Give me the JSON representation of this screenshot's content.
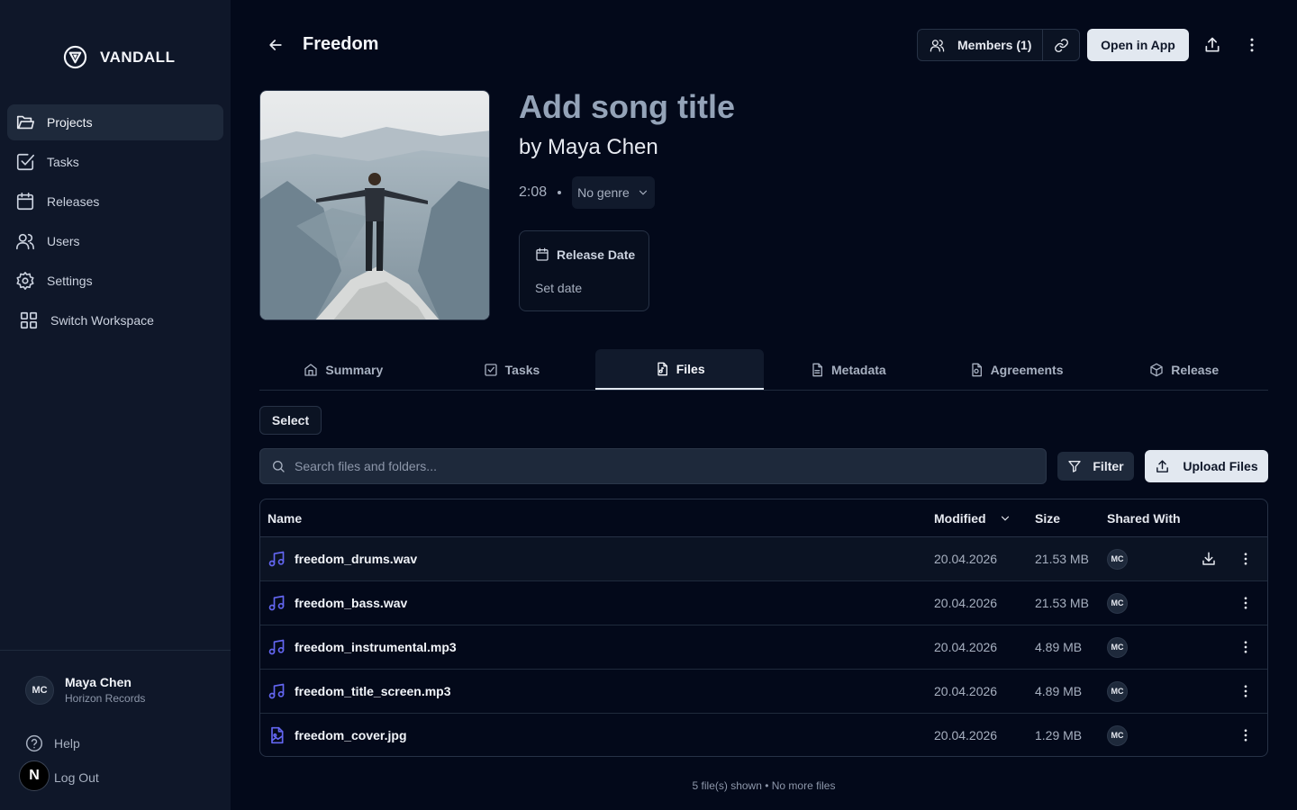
{
  "brand": {
    "name": "VANDALL"
  },
  "sidebar": {
    "items": [
      {
        "label": "Projects",
        "icon": "folder-icon",
        "active": true
      },
      {
        "label": "Tasks",
        "icon": "checkbox-icon"
      },
      {
        "label": "Releases",
        "icon": "calendar-icon"
      },
      {
        "label": "Users",
        "icon": "users-icon"
      },
      {
        "label": "Settings",
        "icon": "gear-icon"
      },
      {
        "label": "Switch Workspace",
        "icon": "grid-icon"
      }
    ],
    "profile": {
      "initials": "MC",
      "name": "Maya Chen",
      "org": "Horizon Records"
    },
    "help_label": "Help",
    "logout_label": "Log Out",
    "badge_letter": "N"
  },
  "header": {
    "title": "Freedom",
    "members_label": "Members (1)",
    "open_app_label": "Open in App"
  },
  "song": {
    "title": "Add song title",
    "artist": "by Maya Chen",
    "duration": "2:08",
    "genre": "No genre",
    "release_label": "Release Date",
    "release_value": "Set date"
  },
  "tabs": [
    {
      "label": "Summary",
      "icon": "home-icon"
    },
    {
      "label": "Tasks",
      "icon": "checkbox-icon"
    },
    {
      "label": "Files",
      "icon": "files-icon",
      "active": true
    },
    {
      "label": "Metadata",
      "icon": "document-icon"
    },
    {
      "label": "Agreements",
      "icon": "contract-icon"
    },
    {
      "label": "Release",
      "icon": "package-icon"
    }
  ],
  "toolbar": {
    "select_label": "Select",
    "search_placeholder": "Search files and folders...",
    "filter_label": "Filter",
    "upload_label": "Upload Files"
  },
  "table": {
    "columns": {
      "name": "Name",
      "modified": "Modified",
      "size": "Size",
      "shared": "Shared With"
    },
    "rows": [
      {
        "name": "freedom_drums.wav",
        "modified": "20.04.2026",
        "size": "21.53 MB",
        "shared": "MC",
        "type": "audio"
      },
      {
        "name": "freedom_bass.wav",
        "modified": "20.04.2026",
        "size": "21.53 MB",
        "shared": "MC",
        "type": "audio"
      },
      {
        "name": "freedom_instrumental.mp3",
        "modified": "20.04.2026",
        "size": "4.89 MB",
        "shared": "MC",
        "type": "audio"
      },
      {
        "name": "freedom_title_screen.mp3",
        "modified": "20.04.2026",
        "size": "4.89 MB",
        "shared": "MC",
        "type": "audio"
      },
      {
        "name": "freedom_cover.jpg",
        "modified": "20.04.2026",
        "size": "1.29 MB",
        "shared": "MC",
        "type": "image"
      }
    ],
    "footer": "5 file(s) shown • No more files"
  },
  "colors": {
    "background": "#03091a",
    "sidebar": "#0f1729",
    "accent": "#6366f1",
    "light_button": "#e2e8f0"
  }
}
